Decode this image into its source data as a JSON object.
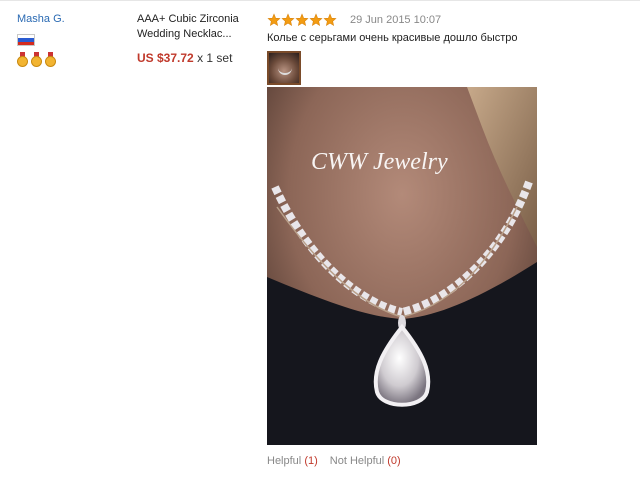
{
  "buyer": {
    "name": "Masha G.",
    "country_flag": "russia-flag-icon",
    "medal_count": 3
  },
  "product": {
    "name": "AAA+ Cubic Zirconia Wedding Necklac...",
    "price": "US $37.72",
    "quantity": "x 1 set"
  },
  "review": {
    "rating": 5,
    "star_color": "#f39c12",
    "date": "29 Jun 2015 10:07",
    "text": "Колье с серьгами очень красивые дошло быстро",
    "photo_watermark": "CWW Jewelry"
  },
  "helpful": {
    "helpful_label": "Helpful",
    "helpful_count": "(1)",
    "not_helpful_label": "Not Helpful",
    "not_helpful_count": "(0)"
  }
}
